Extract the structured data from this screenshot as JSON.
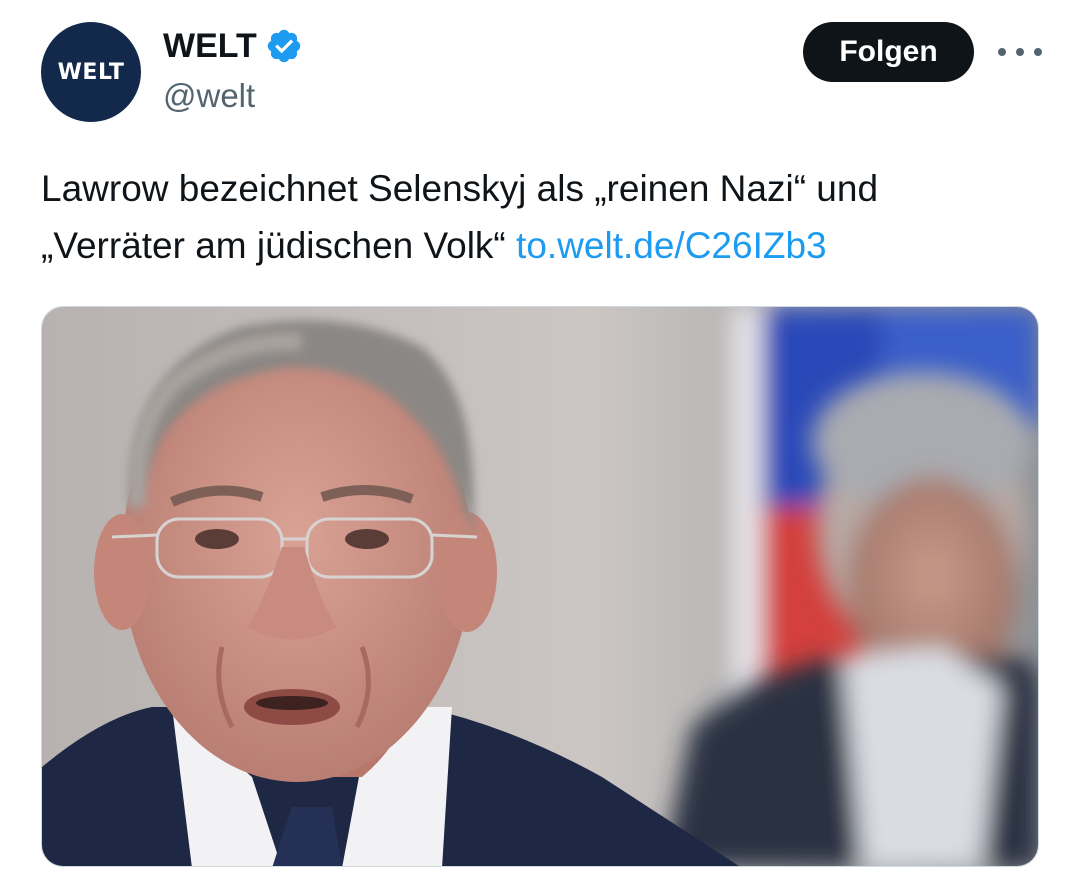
{
  "author": {
    "display_name": "WELT",
    "handle": "@welt",
    "avatar_text": "WELT",
    "avatar_color": "#13294b",
    "verified": true,
    "verified_color": "#1d9bf0"
  },
  "actions": {
    "follow_label": "Folgen",
    "more_icon": "more-horizontal-icon"
  },
  "tweet": {
    "text_line1": "Lawrow bezeichnet Selenskyj als „reinen Nazi“ und",
    "text_line2": "„Verräter am jüdischen Volk“ ",
    "link_text": "to.welt.de/C26IZb3",
    "link_color": "#1d9bf0"
  },
  "media": {
    "alt": "Photo of a man with glasses speaking, blurred flag and person in background"
  }
}
